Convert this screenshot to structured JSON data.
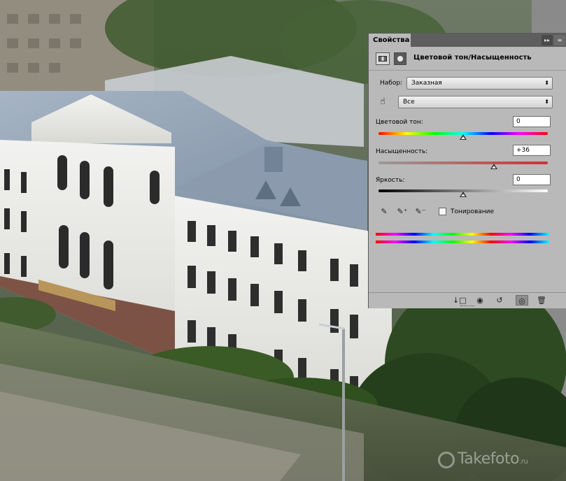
{
  "panel": {
    "tab_label": "Свойства",
    "collapse_icon": "double-chevron-right-icon",
    "menu_icon": "panel-menu-icon",
    "adjustment_icon": "hue-saturation-adjustment-icon",
    "mask_icon": "layer-mask-icon",
    "adjustment_title": "Цветовой тон/Насыщенность",
    "preset_label": "Набор:",
    "preset_value": "Заказная",
    "channel_value": "Все",
    "hue": {
      "label": "Цветовой тон:",
      "value": "0",
      "fraction": 0.5
    },
    "saturation": {
      "label": "Насыщенность:",
      "value": "+36",
      "fraction": 0.68
    },
    "lightness": {
      "label": "Яркость:",
      "value": "0",
      "fraction": 0.5
    },
    "colorize_label": "Тонирование",
    "colorize_checked": false
  },
  "bottom_bar": {
    "icons": [
      "clip-to-layer-icon",
      "view-previous-state-icon",
      "reset-icon",
      "visibility-eye-icon",
      "trash-icon"
    ]
  },
  "watermark": {
    "text": "Takefoto",
    "suffix": ".ru"
  }
}
